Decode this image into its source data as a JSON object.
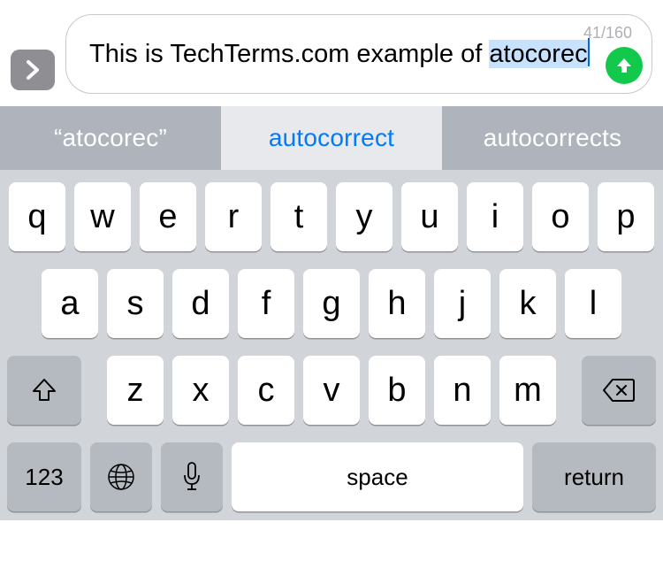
{
  "compose": {
    "text_before": "This is TechTerms.com example of ",
    "highlighted_word": "atocorec",
    "char_count": "41/160"
  },
  "predictions": {
    "left": "“atocorec”",
    "middle": "autocorrect",
    "right": "autocorrects"
  },
  "keyboard": {
    "row1": [
      "q",
      "w",
      "e",
      "r",
      "t",
      "y",
      "u",
      "i",
      "o",
      "p"
    ],
    "row2": [
      "a",
      "s",
      "d",
      "f",
      "g",
      "h",
      "j",
      "k",
      "l"
    ],
    "row3": [
      "z",
      "x",
      "c",
      "v",
      "b",
      "n",
      "m"
    ],
    "numbers_label": "123",
    "space_label": "space",
    "return_label": "return"
  }
}
